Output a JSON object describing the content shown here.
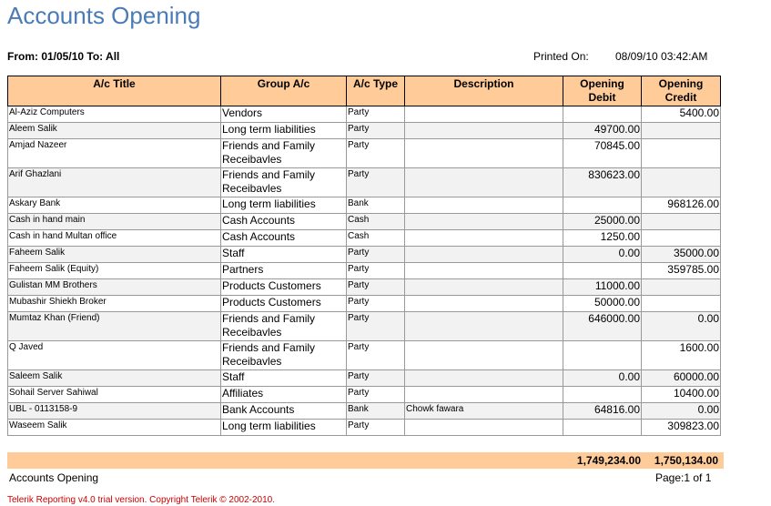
{
  "report": {
    "title": "Accounts Opening",
    "from_to": "From: 01/05/10 To: All",
    "printed_label": "Printed On:",
    "printed_value": "08/09/10 03:42:AM"
  },
  "columns": {
    "title": "A/c Title",
    "group": "Group A/c",
    "type": "A/c Type",
    "description": "Description",
    "debit": "Opening Debit",
    "credit": "Opening Credit"
  },
  "rows": [
    {
      "title": "Al-Aziz Computers",
      "group": "Vendors",
      "type": "Party",
      "description": "",
      "debit": "",
      "credit": "5400.00"
    },
    {
      "title": "Aleem Salik",
      "group": "Long term liabilities",
      "type": "Party",
      "description": "",
      "debit": "49700.00",
      "credit": ""
    },
    {
      "title": "Amjad Nazeer",
      "group": "Friends and Family Receibavles",
      "type": "Party",
      "description": "",
      "debit": "70845.00",
      "credit": ""
    },
    {
      "title": "Arif Ghazlani",
      "group": "Friends and Family Receibavles",
      "type": "Party",
      "description": "",
      "debit": "830623.00",
      "credit": ""
    },
    {
      "title": "Askary Bank",
      "group": "Long term liabilities",
      "type": "Bank",
      "description": "",
      "debit": "",
      "credit": "968126.00"
    },
    {
      "title": "Cash in hand main",
      "group": "Cash Accounts",
      "type": "Cash",
      "description": "",
      "debit": "25000.00",
      "credit": ""
    },
    {
      "title": "Cash in hand Multan office",
      "group": "Cash Accounts",
      "type": "Cash",
      "description": "",
      "debit": "1250.00",
      "credit": ""
    },
    {
      "title": "Faheem Salik",
      "group": "Staff",
      "type": "Party",
      "description": "",
      "debit": "0.00",
      "credit": "35000.00"
    },
    {
      "title": "Faheem Salik (Equity)",
      "group": "Partners",
      "type": "Party",
      "description": "",
      "debit": "",
      "credit": "359785.00"
    },
    {
      "title": "Gulistan MM Brothers",
      "group": "Products Customers",
      "type": "Party",
      "description": "",
      "debit": "11000.00",
      "credit": ""
    },
    {
      "title": "Mubashir Shiekh Broker",
      "group": "Products Customers",
      "type": "Party",
      "description": "",
      "debit": "50000.00",
      "credit": ""
    },
    {
      "title": "Mumtaz Khan (Friend)",
      "group": "Friends and Family Receibavles",
      "type": "Party",
      "description": "",
      "debit": "646000.00",
      "credit": "0.00"
    },
    {
      "title": "Q Javed",
      "group": "Friends and Family Receibavles",
      "type": "Party",
      "description": "",
      "debit": "",
      "credit": "1600.00"
    },
    {
      "title": "Saleem Salik",
      "group": "Staff",
      "type": "Party",
      "description": "",
      "debit": "0.00",
      "credit": "60000.00"
    },
    {
      "title": "Sohail Server Sahiwal",
      "group": "Affiliates",
      "type": "Party",
      "description": "",
      "debit": "",
      "credit": "10400.00"
    },
    {
      "title": "UBL - 0113158-9",
      "group": "Bank Accounts",
      "type": "Bank",
      "description": "Chowk fawara",
      "debit": "64816.00",
      "credit": "0.00"
    },
    {
      "title": "Waseem Salik",
      "group": "Long term liabilities",
      "type": "Party",
      "description": "",
      "debit": "",
      "credit": "309823.00"
    }
  ],
  "totals": {
    "debit": "1,749,234.00",
    "credit": "1,750,134.00"
  },
  "footer": {
    "left": "Accounts Opening",
    "page": "Page:1 of 1",
    "copyright": "Telerik Reporting v4.0 trial version. Copyright Telerik © 2002-2010."
  }
}
